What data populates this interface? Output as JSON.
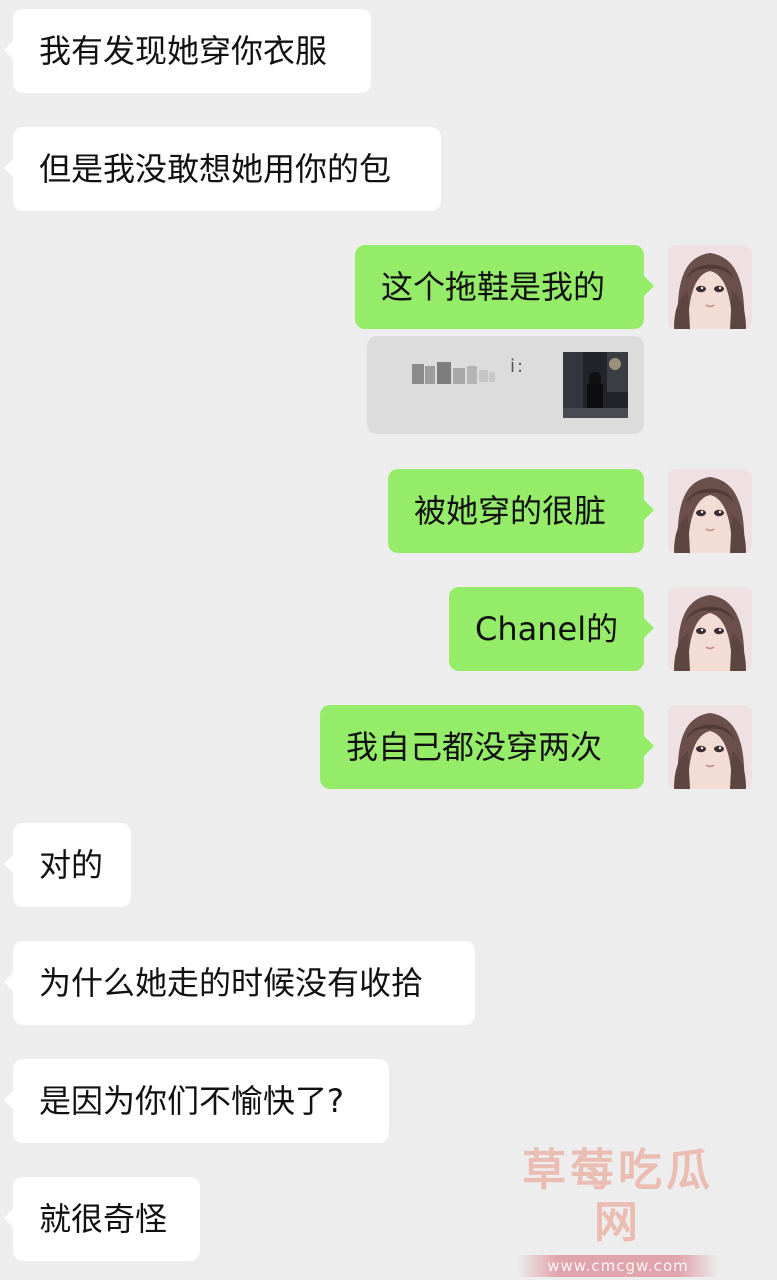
{
  "messages": [
    {
      "side": "left",
      "text": "我有发现她穿你衣服"
    },
    {
      "side": "left",
      "text": "但是我没敢想她用你的包"
    },
    {
      "side": "right",
      "text": "这个拖鞋是我的"
    },
    {
      "side": "right",
      "text": "被她穿的很脏"
    },
    {
      "side": "right",
      "text": "Chanel的"
    },
    {
      "side": "right",
      "text": "我自己都没穿两次"
    },
    {
      "side": "left",
      "text": "对的"
    },
    {
      "side": "left",
      "text": "为什么她走的时候没有收拾"
    },
    {
      "side": "left",
      "text": "是因为你们不愉快了?"
    },
    {
      "side": "left",
      "text": "就很奇怪"
    }
  ],
  "quote": {
    "label": "i:",
    "blurred": true
  },
  "watermark": {
    "title": "草莓吃瓜网",
    "url": "www.cmcgw.com"
  },
  "colors": {
    "background": "#ededed",
    "incoming_bubble": "#ffffff",
    "outgoing_bubble": "#95ec69"
  },
  "icons": {
    "avatar": "anime-girl-avatar"
  }
}
